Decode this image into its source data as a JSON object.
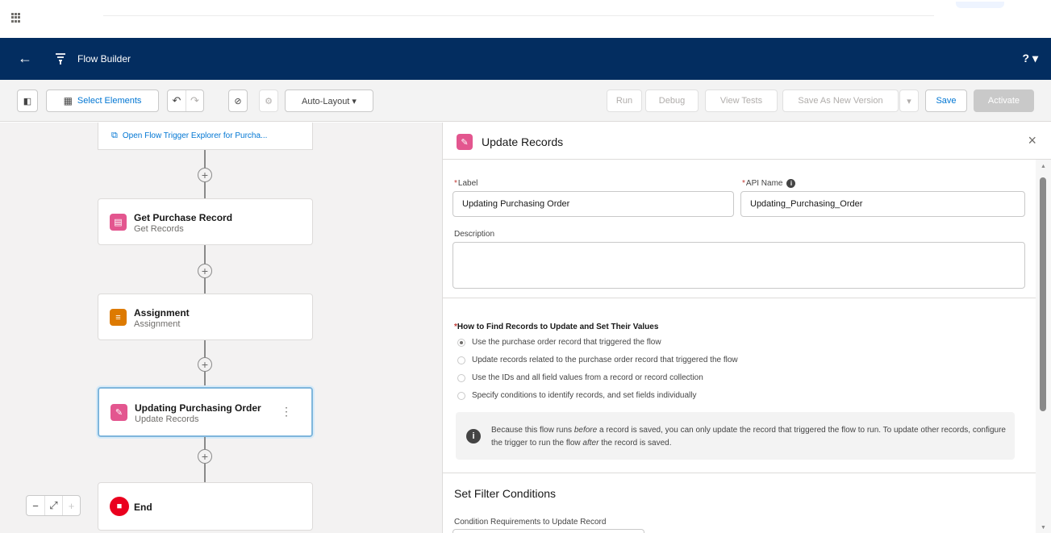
{
  "header": {
    "title": "Flow Builder",
    "help": "? ▾"
  },
  "toolbar": {
    "select_elements": "Select Elements",
    "layout": "Auto-Layout ▾",
    "run": "Run",
    "debug": "Debug",
    "view_tests": "View Tests",
    "save_as_new_version": "Save As New Version",
    "save": "Save",
    "activate": "Activate"
  },
  "canvas": {
    "trigger_link": "Open Flow Trigger Explorer for Purcha...",
    "nodes": [
      {
        "title": "Get Purchase Record",
        "subtitle": "Get Records",
        "color": "#e3568f"
      },
      {
        "title": "Assignment",
        "subtitle": "Assignment",
        "color": "#dd7a01"
      },
      {
        "title": "Updating Purchasing Order",
        "subtitle": "Update Records",
        "color": "#e3568f"
      },
      {
        "title": "End",
        "color": "#ea001e"
      }
    ]
  },
  "panel": {
    "title": "Update Records",
    "label_field": {
      "label": "Label",
      "value": "Updating Purchasing Order"
    },
    "api_field": {
      "label": "API Name",
      "value": "Updating_Purchasing_Order"
    },
    "description_label": "Description",
    "how_to_find": "How to Find Records to Update and Set Their Values",
    "options": [
      "Use the purchase order record that triggered the flow",
      "Update records related to the purchase order record that triggered the flow",
      "Use the IDs and all field values from a record or record collection",
      "Specify conditions to identify records, and set fields individually"
    ],
    "selected_option": 0,
    "notice_pre": "Because this flow runs ",
    "notice_em1": "before",
    "notice_mid": " a record is saved, you can only update the record that triggered the flow to run. To update other records, configure the trigger to run the flow ",
    "notice_em2": "after",
    "notice_post": " the record is saved.",
    "filter_title": "Set Filter Conditions",
    "condition_label": "Condition Requirements to Update Record"
  }
}
